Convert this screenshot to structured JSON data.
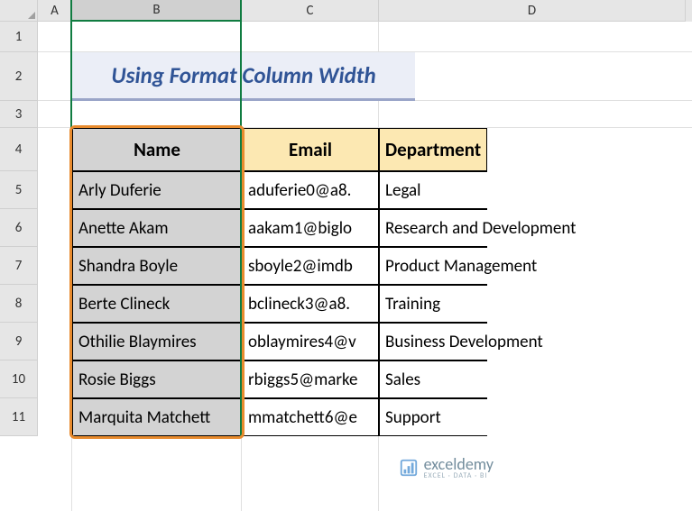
{
  "columns": {
    "A": "A",
    "B": "B",
    "C": "C",
    "D": "D"
  },
  "rows": [
    "1",
    "2",
    "3",
    "4",
    "5",
    "6",
    "7",
    "8",
    "9",
    "10",
    "11"
  ],
  "title": "Using Format Column Width",
  "headers": {
    "name": "Name",
    "email": "Email",
    "department": "Department"
  },
  "data": [
    {
      "name": "Arly Duferie",
      "email": "aduferie0@a8.",
      "department": "Legal"
    },
    {
      "name": "Anette Akam",
      "email": "aakam1@biglo",
      "department": "Research and Development"
    },
    {
      "name": "Shandra Boyle",
      "email": "sboyle2@imdb",
      "department": "Product Management"
    },
    {
      "name": "Berte Clineck",
      "email": "bclineck3@a8.",
      "department": "Training"
    },
    {
      "name": "Othilie Blaymires",
      "email": "oblaymires4@v",
      "department": "Business Development"
    },
    {
      "name": "Rosie Biggs",
      "email": "rbiggs5@marke",
      "department": "Sales"
    },
    {
      "name": "Marquita Matchett",
      "email": "mmatchett6@e",
      "department": "Support"
    }
  ],
  "logo": {
    "text": "exceldemy",
    "sub": "EXCEL · DATA · BI"
  }
}
